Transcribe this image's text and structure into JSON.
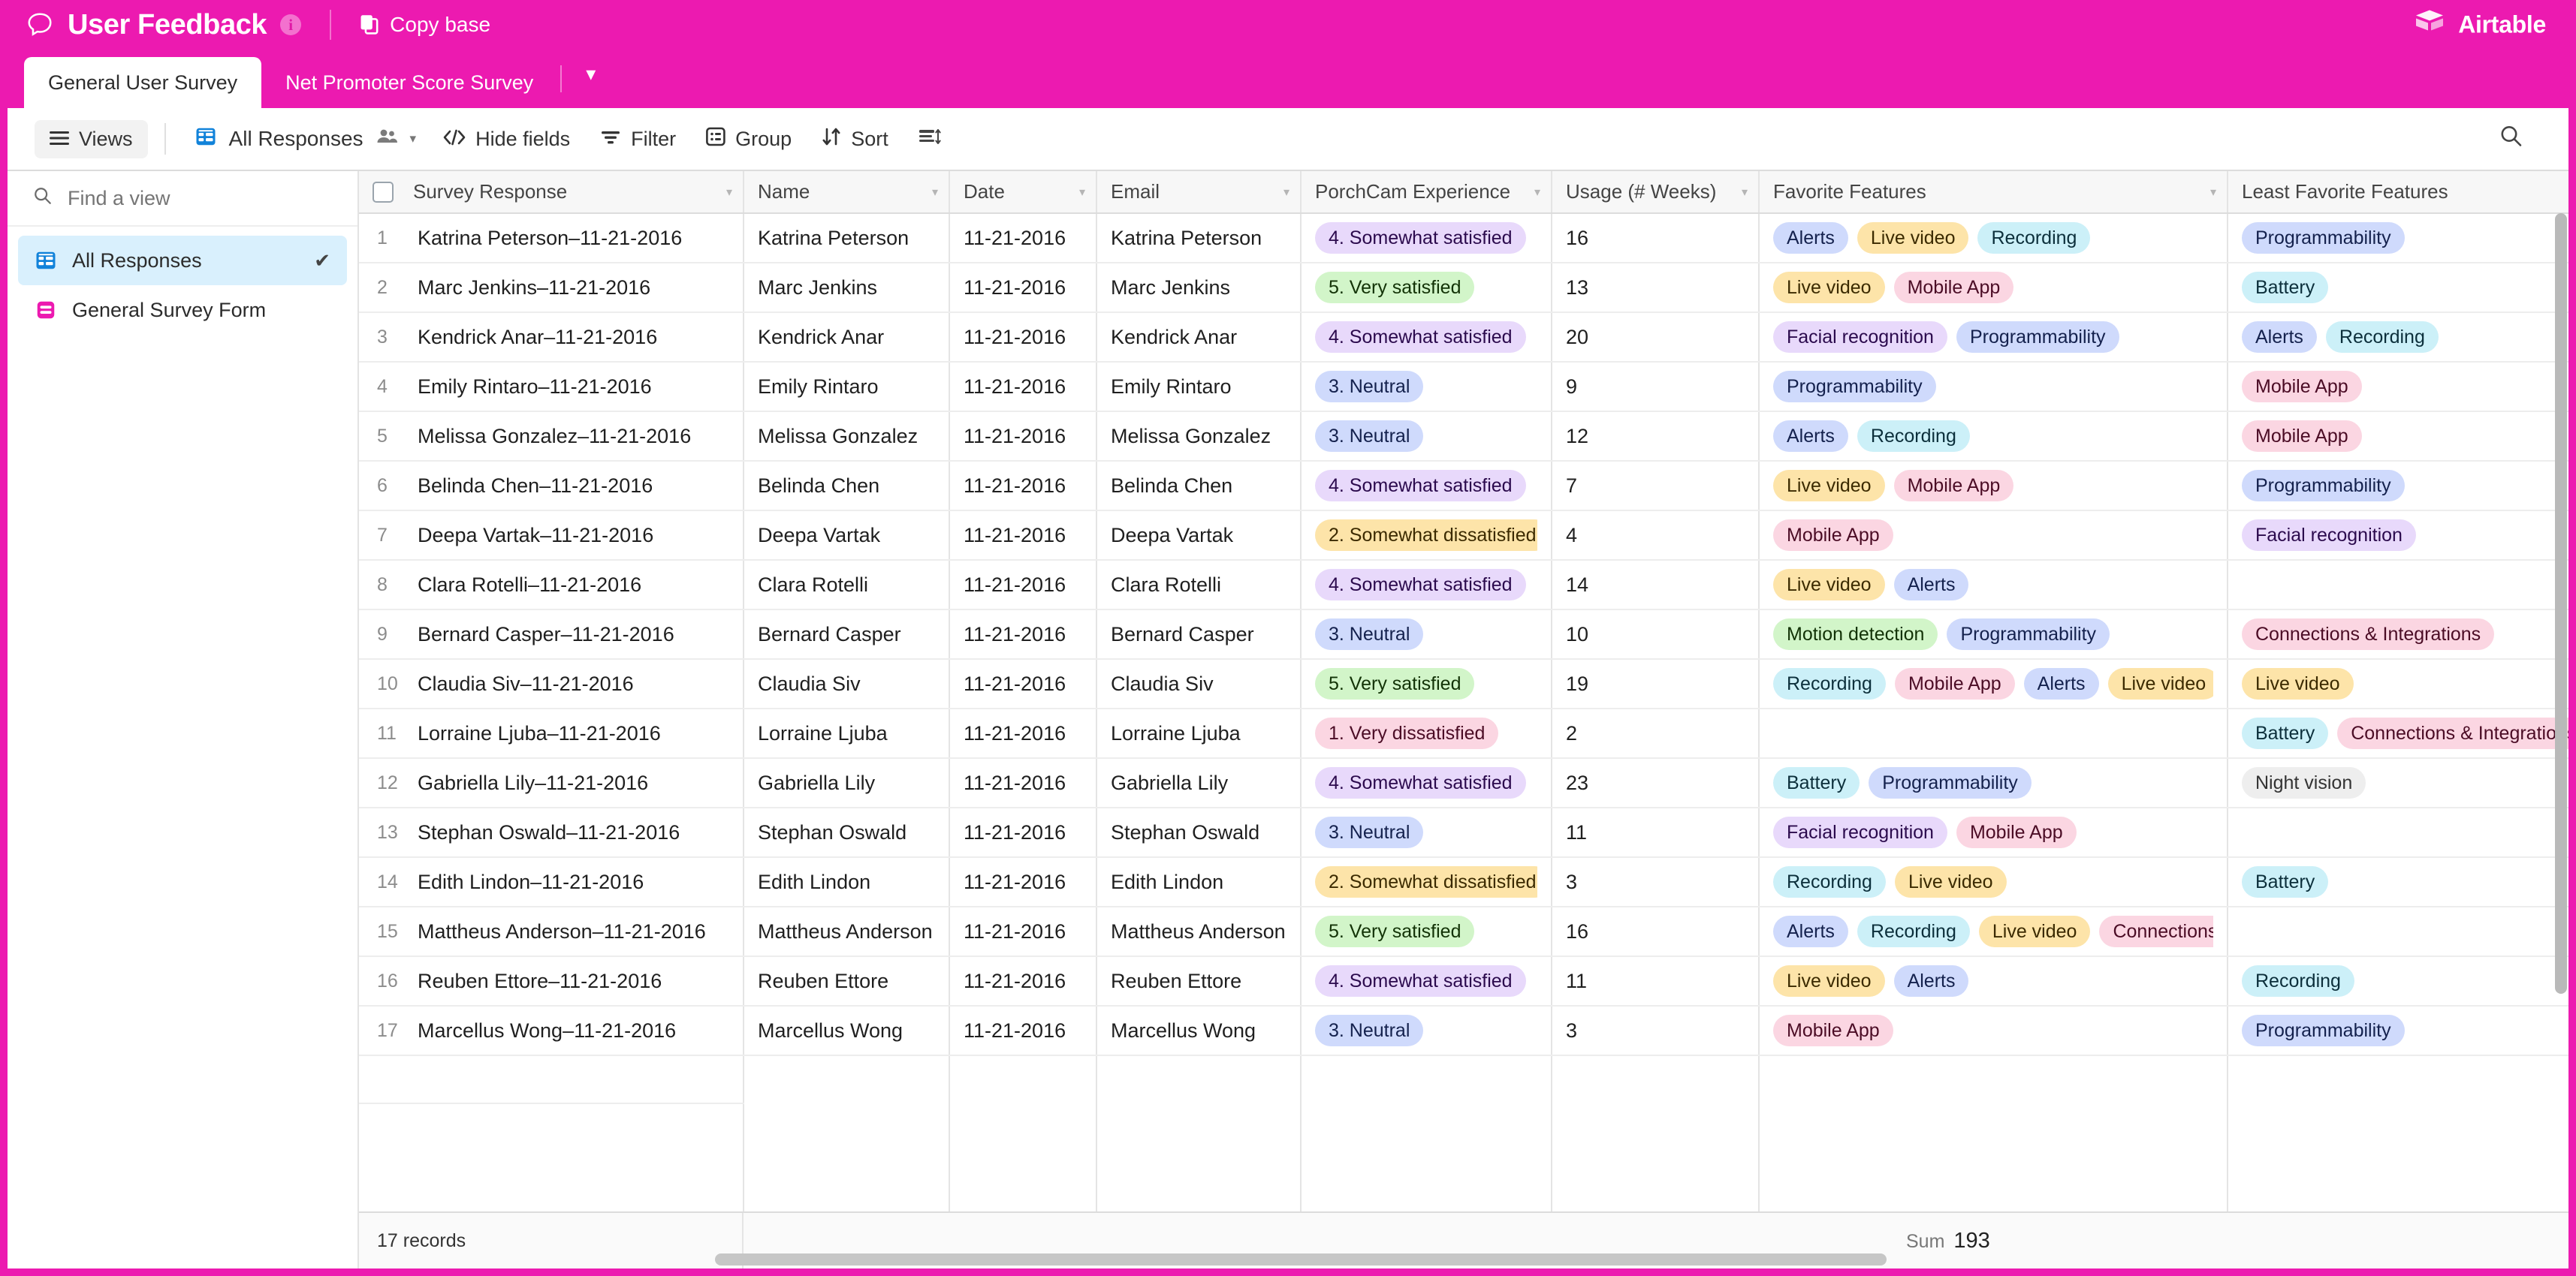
{
  "header": {
    "base_title": "User Feedback",
    "info_icon": "info-icon",
    "speech_icon": "speech-bubble-icon",
    "copy_base_label": "Copy base",
    "copy_icon": "copy-icon",
    "brand": "Airtable",
    "brand_icon": "airtable-logo-icon",
    "brand_color": "#ec1ab0"
  },
  "tabs": {
    "items": [
      {
        "label": "General User Survey",
        "active": true
      },
      {
        "label": "Net Promoter Score Survey",
        "active": false
      }
    ],
    "caret": "▾"
  },
  "toolbar": {
    "views_label": "Views",
    "views_icon": "hamburger-icon",
    "view_name": "All Responses",
    "view_grid_icon": "grid-view-icon",
    "collaborators_icon": "people-icon",
    "view_caret": "▾",
    "hide_fields_label": "Hide fields",
    "hide_fields_icon": "code-brackets-icon",
    "filter_label": "Filter",
    "filter_icon": "funnel-icon",
    "group_label": "Group",
    "group_icon": "group-list-icon",
    "sort_label": "Sort",
    "sort_icon": "sort-arrows-icon",
    "row_height_icon": "row-height-icon",
    "search_icon": "search-icon"
  },
  "sidebar": {
    "search_placeholder": "Find a view",
    "search_icon": "search-icon",
    "views": [
      {
        "label": "All Responses",
        "icon": "grid-view-icon",
        "selected": true,
        "check": "✔"
      },
      {
        "label": "General Survey Form",
        "icon": "form-view-icon",
        "selected": false,
        "check": ""
      }
    ]
  },
  "grid": {
    "columns": [
      {
        "key": "primary",
        "label": "Survey Response"
      },
      {
        "key": "name",
        "label": "Name"
      },
      {
        "key": "date",
        "label": "Date"
      },
      {
        "key": "email",
        "label": "Email"
      },
      {
        "key": "experience",
        "label": "PorchCam Experience"
      },
      {
        "key": "usage",
        "label": "Usage (# Weeks)"
      },
      {
        "key": "favorite",
        "label": "Favorite Features"
      },
      {
        "key": "least",
        "label": "Least Favorite Features"
      }
    ],
    "header_caret": "▾",
    "select_all_checkbox": "checkbox",
    "rows": [
      {
        "n": "1",
        "primary": "Katrina Peterson–11-21-2016",
        "name": "Katrina Peterson",
        "date": "11-21-2016",
        "email": "Katrina Peterson",
        "experience": {
          "label": "4. Somewhat satisfied",
          "color": "purple"
        },
        "usage": "16",
        "favorite": [
          {
            "label": "Alerts",
            "color": "blue"
          },
          {
            "label": "Live video",
            "color": "yellow"
          },
          {
            "label": "Recording",
            "color": "cyan"
          }
        ],
        "least": [
          {
            "label": "Programmability",
            "color": "blue"
          }
        ]
      },
      {
        "n": "2",
        "primary": "Marc Jenkins–11-21-2016",
        "name": "Marc Jenkins",
        "date": "11-21-2016",
        "email": "Marc Jenkins",
        "experience": {
          "label": "5. Very satisfied",
          "color": "green"
        },
        "usage": "13",
        "favorite": [
          {
            "label": "Live video",
            "color": "yellow"
          },
          {
            "label": "Mobile App",
            "color": "pink"
          }
        ],
        "least": [
          {
            "label": "Battery",
            "color": "cyan"
          }
        ]
      },
      {
        "n": "3",
        "primary": "Kendrick Anar–11-21-2016",
        "name": "Kendrick Anar",
        "date": "11-21-2016",
        "email": "Kendrick Anar",
        "experience": {
          "label": "4. Somewhat satisfied",
          "color": "purple"
        },
        "usage": "20",
        "favorite": [
          {
            "label": "Facial recognition",
            "color": "purple"
          },
          {
            "label": "Programmability",
            "color": "blue"
          }
        ],
        "least": [
          {
            "label": "Alerts",
            "color": "blue"
          },
          {
            "label": "Recording",
            "color": "cyan"
          }
        ]
      },
      {
        "n": "4",
        "primary": "Emily Rintaro–11-21-2016",
        "name": "Emily Rintaro",
        "date": "11-21-2016",
        "email": "Emily Rintaro",
        "experience": {
          "label": "3. Neutral",
          "color": "blue"
        },
        "usage": "9",
        "favorite": [
          {
            "label": "Programmability",
            "color": "blue"
          }
        ],
        "least": [
          {
            "label": "Mobile App",
            "color": "pink"
          }
        ]
      },
      {
        "n": "5",
        "primary": "Melissa Gonzalez–11-21-2016",
        "name": "Melissa Gonzalez",
        "date": "11-21-2016",
        "email": "Melissa Gonzalez",
        "experience": {
          "label": "3. Neutral",
          "color": "blue"
        },
        "usage": "12",
        "favorite": [
          {
            "label": "Alerts",
            "color": "blue"
          },
          {
            "label": "Recording",
            "color": "cyan"
          }
        ],
        "least": [
          {
            "label": "Mobile App",
            "color": "pink"
          }
        ]
      },
      {
        "n": "6",
        "primary": "Belinda Chen–11-21-2016",
        "name": "Belinda Chen",
        "date": "11-21-2016",
        "email": "Belinda Chen",
        "experience": {
          "label": "4. Somewhat satisfied",
          "color": "purple"
        },
        "usage": "7",
        "favorite": [
          {
            "label": "Live video",
            "color": "yellow"
          },
          {
            "label": "Mobile App",
            "color": "pink"
          }
        ],
        "least": [
          {
            "label": "Programmability",
            "color": "blue"
          }
        ]
      },
      {
        "n": "7",
        "primary": "Deepa Vartak–11-21-2016",
        "name": "Deepa Vartak",
        "date": "11-21-2016",
        "email": "Deepa Vartak",
        "experience": {
          "label": "2. Somewhat dissatisfied",
          "color": "yellow"
        },
        "usage": "4",
        "favorite": [
          {
            "label": "Mobile App",
            "color": "pink"
          }
        ],
        "least": [
          {
            "label": "Facial recognition",
            "color": "purple"
          }
        ]
      },
      {
        "n": "8",
        "primary": "Clara Rotelli–11-21-2016",
        "name": "Clara Rotelli",
        "date": "11-21-2016",
        "email": "Clara Rotelli",
        "experience": {
          "label": "4. Somewhat satisfied",
          "color": "purple"
        },
        "usage": "14",
        "favorite": [
          {
            "label": "Live video",
            "color": "yellow"
          },
          {
            "label": "Alerts",
            "color": "blue"
          }
        ],
        "least": []
      },
      {
        "n": "9",
        "primary": "Bernard Casper–11-21-2016",
        "name": "Bernard Casper",
        "date": "11-21-2016",
        "email": "Bernard Casper",
        "experience": {
          "label": "3. Neutral",
          "color": "blue"
        },
        "usage": "10",
        "favorite": [
          {
            "label": "Motion detection",
            "color": "green"
          },
          {
            "label": "Programmability",
            "color": "blue"
          }
        ],
        "least": [
          {
            "label": "Connections & Integrations",
            "color": "pink"
          }
        ]
      },
      {
        "n": "10",
        "primary": "Claudia Siv–11-21-2016",
        "name": "Claudia Siv",
        "date": "11-21-2016",
        "email": "Claudia Siv",
        "experience": {
          "label": "5. Very satisfied",
          "color": "green"
        },
        "usage": "19",
        "favorite": [
          {
            "label": "Recording",
            "color": "cyan"
          },
          {
            "label": "Mobile App",
            "color": "pink"
          },
          {
            "label": "Alerts",
            "color": "blue"
          },
          {
            "label": "Live video",
            "color": "yellow"
          }
        ],
        "least": [
          {
            "label": "Live video",
            "color": "yellow"
          }
        ]
      },
      {
        "n": "11",
        "primary": "Lorraine Ljuba–11-21-2016",
        "name": "Lorraine Ljuba",
        "date": "11-21-2016",
        "email": "Lorraine Ljuba",
        "experience": {
          "label": "1. Very dissatisfied",
          "color": "pink"
        },
        "usage": "2",
        "favorite": [],
        "least": [
          {
            "label": "Battery",
            "color": "cyan"
          },
          {
            "label": "Connections & Integrations",
            "color": "pink"
          }
        ]
      },
      {
        "n": "12",
        "primary": "Gabriella Lily–11-21-2016",
        "name": "Gabriella Lily",
        "date": "11-21-2016",
        "email": "Gabriella Lily",
        "experience": {
          "label": "4. Somewhat satisfied",
          "color": "purple"
        },
        "usage": "23",
        "favorite": [
          {
            "label": "Battery",
            "color": "cyan"
          },
          {
            "label": "Programmability",
            "color": "blue"
          }
        ],
        "least": [
          {
            "label": "Night vision",
            "color": "gray"
          }
        ]
      },
      {
        "n": "13",
        "primary": "Stephan Oswald–11-21-2016",
        "name": "Stephan Oswald",
        "date": "11-21-2016",
        "email": "Stephan Oswald",
        "experience": {
          "label": "3. Neutral",
          "color": "blue"
        },
        "usage": "11",
        "favorite": [
          {
            "label": "Facial recognition",
            "color": "purple"
          },
          {
            "label": "Mobile App",
            "color": "pink"
          }
        ],
        "least": []
      },
      {
        "n": "14",
        "primary": "Edith Lindon–11-21-2016",
        "name": "Edith Lindon",
        "date": "11-21-2016",
        "email": "Edith Lindon",
        "experience": {
          "label": "2. Somewhat dissatisfied",
          "color": "yellow"
        },
        "usage": "3",
        "favorite": [
          {
            "label": "Recording",
            "color": "cyan"
          },
          {
            "label": "Live video",
            "color": "yellow"
          }
        ],
        "least": [
          {
            "label": "Battery",
            "color": "cyan"
          }
        ]
      },
      {
        "n": "15",
        "primary": "Mattheus Anderson–11-21-2016",
        "name": "Mattheus Anderson",
        "date": "11-21-2016",
        "email": "Mattheus Anderson",
        "experience": {
          "label": "5. Very satisfied",
          "color": "green"
        },
        "usage": "16",
        "favorite": [
          {
            "label": "Alerts",
            "color": "blue"
          },
          {
            "label": "Recording",
            "color": "cyan"
          },
          {
            "label": "Live video",
            "color": "yellow"
          },
          {
            "label": "Connections & Integrations",
            "color": "pink"
          }
        ],
        "least": []
      },
      {
        "n": "16",
        "primary": "Reuben Ettore–11-21-2016",
        "name": "Reuben Ettore",
        "date": "11-21-2016",
        "email": "Reuben Ettore",
        "experience": {
          "label": "4. Somewhat satisfied",
          "color": "purple"
        },
        "usage": "11",
        "favorite": [
          {
            "label": "Live video",
            "color": "yellow"
          },
          {
            "label": "Alerts",
            "color": "blue"
          }
        ],
        "least": [
          {
            "label": "Recording",
            "color": "cyan"
          }
        ]
      },
      {
        "n": "17",
        "primary": "Marcellus Wong–11-21-2016",
        "name": "Marcellus Wong",
        "date": "11-21-2016",
        "email": "Marcellus Wong",
        "experience": {
          "label": "3. Neutral",
          "color": "blue"
        },
        "usage": "3",
        "favorite": [
          {
            "label": "Mobile App",
            "color": "pink"
          }
        ],
        "least": [
          {
            "label": "Programmability",
            "color": "blue"
          }
        ]
      }
    ]
  },
  "footer": {
    "record_count": "17 records",
    "sum_label": "Sum",
    "sum_value": "193"
  }
}
